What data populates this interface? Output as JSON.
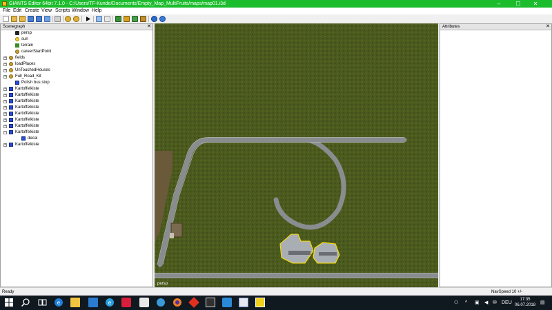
{
  "window": {
    "title": "GIANTS Editor 64bit 7.1.0 - C:/Users/TF-Kunde/Documents/Empty_Map_MultiFruits/maps/map01.i3d",
    "minimize": "–",
    "maximize": "☐",
    "close": "✕"
  },
  "menu": [
    "File",
    "Edit",
    "Create",
    "View",
    "Scripts",
    "Window",
    "Help"
  ],
  "scenegraph": {
    "title": "Scenegraph",
    "close": "✕",
    "nodes": [
      {
        "label": "persp",
        "icon": "camera-icon",
        "expand": ""
      },
      {
        "label": "sun",
        "icon": "light-icon",
        "expand": ""
      },
      {
        "label": "terrain",
        "icon": "terrain-icon",
        "expand": ""
      },
      {
        "label": "careerStartPoint",
        "icon": "transform-icon",
        "expand": ""
      },
      {
        "label": "fields",
        "icon": "transform-icon",
        "expand": "+"
      },
      {
        "label": "loadPlaces",
        "icon": "transform-icon",
        "expand": "+"
      },
      {
        "label": "UnTouchedHouses",
        "icon": "transform-icon",
        "expand": "+"
      },
      {
        "label": "Full_Road_Kit",
        "icon": "transform-icon",
        "expand": "+"
      },
      {
        "label": "Polish bus stop",
        "icon": "shape-icon",
        "expand": ""
      },
      {
        "label": "Kartoffelkiste",
        "icon": "shape-icon",
        "expand": "+"
      },
      {
        "label": "Kartoffelkiste",
        "icon": "shape-icon",
        "expand": "+"
      },
      {
        "label": "Kartoffelkiste",
        "icon": "shape-icon",
        "expand": "+"
      },
      {
        "label": "Kartoffelkiste",
        "icon": "shape-icon",
        "expand": "+"
      },
      {
        "label": "Kartoffelkiste",
        "icon": "shape-icon",
        "expand": "+"
      },
      {
        "label": "Kartoffelkiste",
        "icon": "shape-icon",
        "expand": "+"
      },
      {
        "label": "Kartoffelkiste",
        "icon": "shape-icon",
        "expand": "+"
      },
      {
        "label": "Kartoffelkiste",
        "icon": "shape-icon",
        "expand": "−"
      },
      {
        "label": "decal",
        "icon": "shape-icon",
        "expand": ""
      },
      {
        "label": "Kartoffelkiste",
        "icon": "shape-icon",
        "expand": "+"
      }
    ]
  },
  "attributes": {
    "title": "Attributes",
    "close": "✕"
  },
  "viewport": {
    "label": "persp"
  },
  "status": {
    "left": "Ready",
    "right": "NavSpeed 10 +/-"
  },
  "taskbar": {
    "time": "17:35",
    "date": "06.07.2018",
    "language": "DEU"
  },
  "colors": {
    "titlebar": "#1cbd2c",
    "terrain": "#49581c",
    "road": "#8a8d8f",
    "taskbar": "#101820"
  }
}
